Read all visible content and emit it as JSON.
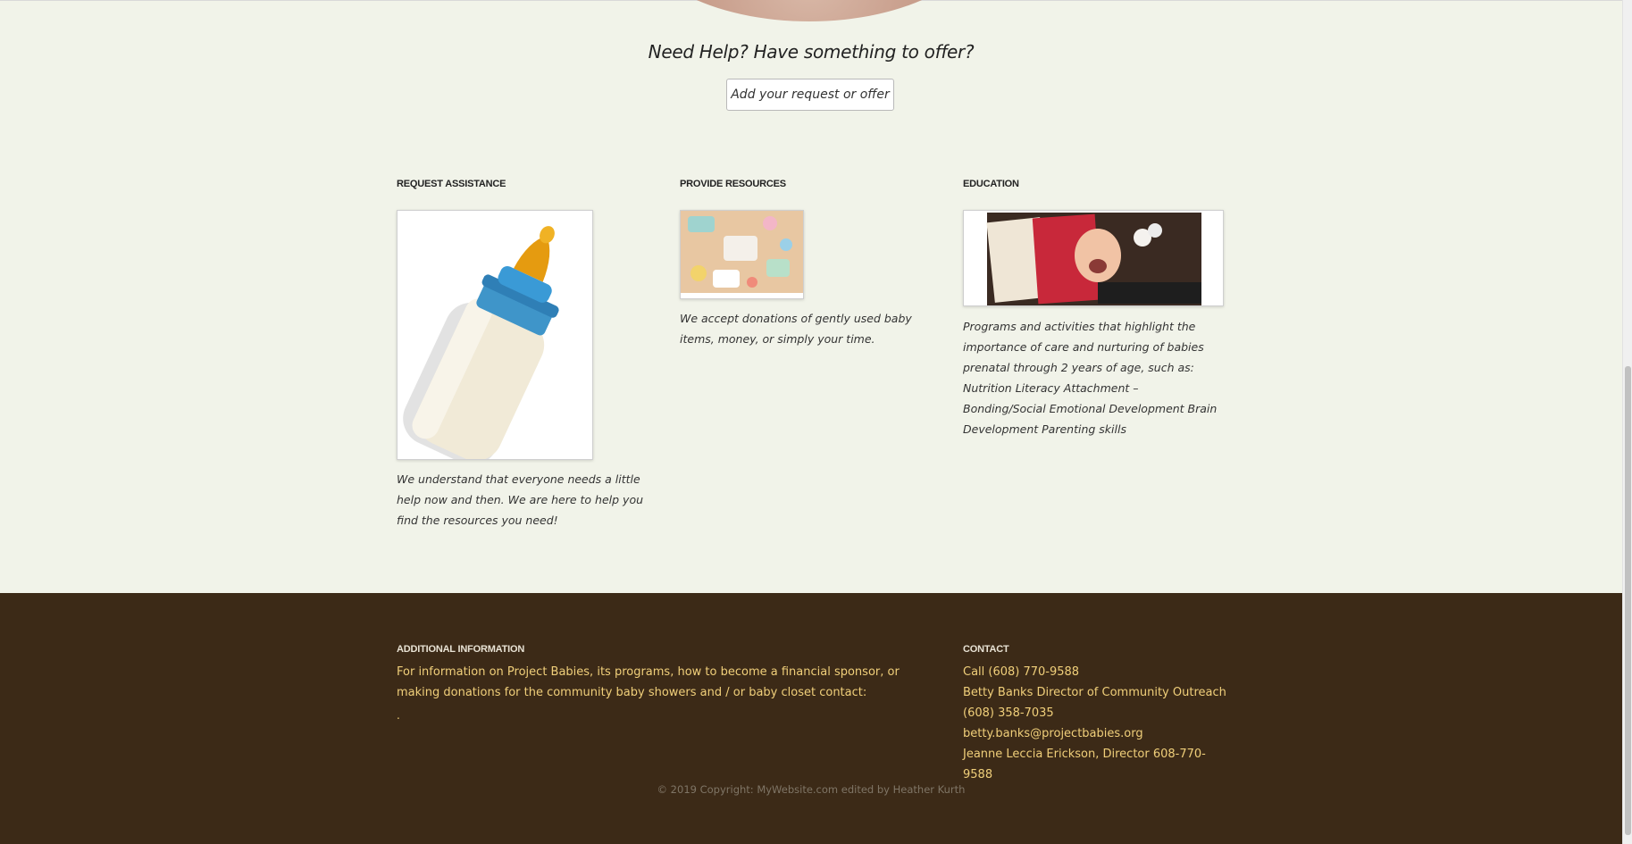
{
  "help": {
    "heading": "Need Help? Have something to offer?",
    "button_label": "Add your request or offer"
  },
  "columns": [
    {
      "title": "REQUEST ASSISTANCE",
      "image": "baby-bottle-image",
      "text": "We understand that everyone needs a little help now and then. We are here to help you find the resources you need!"
    },
    {
      "title": "PROVIDE RESOURCES",
      "image": "baby-items-image",
      "text": "We accept donations of gently used baby items, money, or simply your time."
    },
    {
      "title": "EDUCATION",
      "image": "baby-books-image",
      "text": "Programs and activities that highlight the importance of care and nurturing of babies prenatal through 2 years of age, such as: Nutrition Literacy Attachment – Bonding/Social Emotional Development Brain Development Parenting skills"
    }
  ],
  "footer": {
    "additional": {
      "title": "ADDITIONAL INFORMATION",
      "text": "For information on Project Babies, its programs, how to become a financial sponsor, or making donations for the community baby showers and / or baby closet contact:",
      "dot": "."
    },
    "contact": {
      "title": "CONTACT",
      "lines": [
        "Call (608) 770-9588",
        "Betty Banks Director of Community Outreach (608) 358-7035 betty.banks@projectbabies.org",
        "Jeanne Leccia Erickson, Director 608-770-9588"
      ]
    },
    "copyright": "© 2019 Copyright: MyWebsite.com edited by Heather Kurth"
  },
  "colors": {
    "page_bg": "#f1f3e9",
    "footer_bg": "#3c2a17",
    "footer_text": "#f0cf7a",
    "footer_title": "#e8e2d4"
  }
}
